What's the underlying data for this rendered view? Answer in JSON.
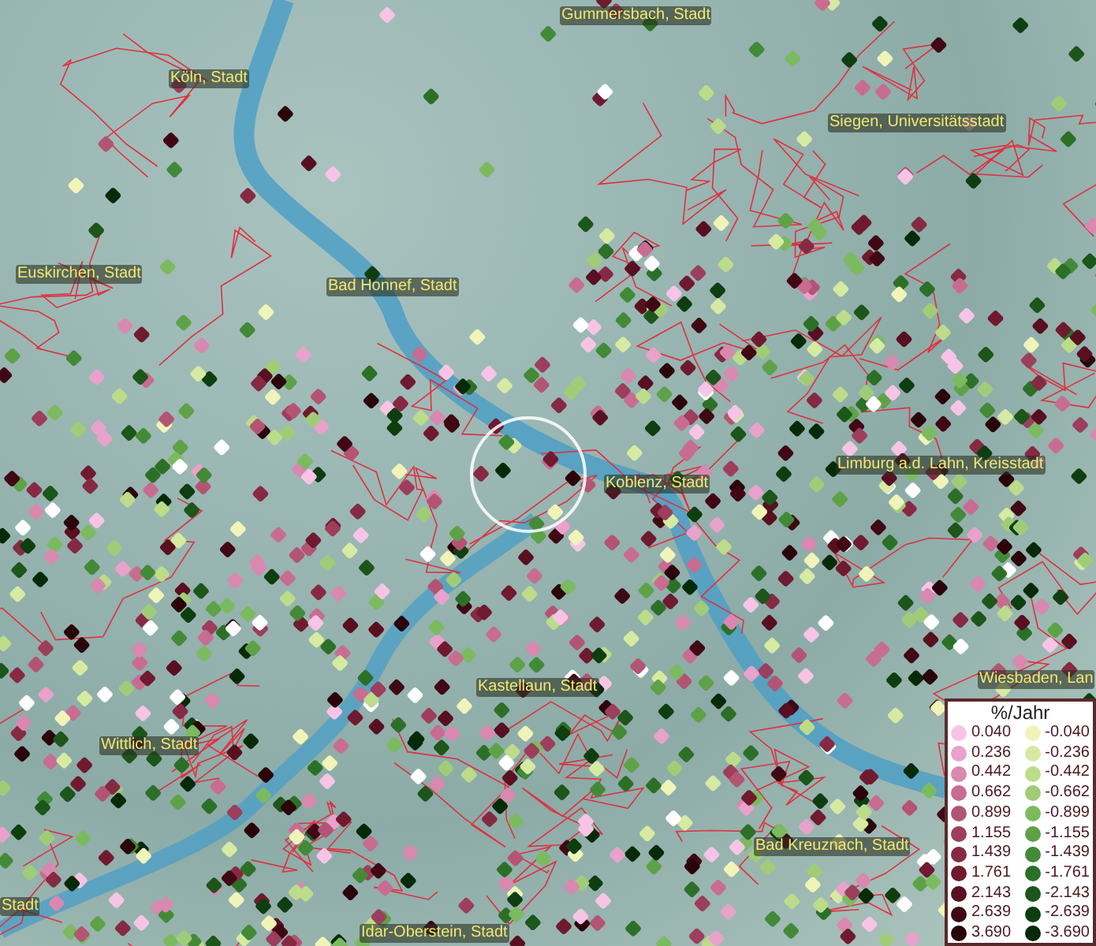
{
  "places": [
    "Gummersbach, Stadt",
    "Köln, Stadt",
    "Siegen, Universitätsstadt",
    "Euskirchen, Stadt",
    "Bad Honnef, Stadt",
    "Koblenz, Stadt",
    "Limburg a.d. Lahn, Kreisstadt",
    "Wiesbaden, Lan",
    "Kastellaun, Stadt",
    "Wittlich, Stadt",
    "Bad Kreuznach, Stadt",
    "Stadt",
    "Idar-Oberstein, Stadt"
  ],
  "legend": {
    "title": "%/Jahr",
    "rising": [
      {
        "value": "0.040",
        "color": "#f7c4e6"
      },
      {
        "value": "0.236",
        "color": "#e8a2cc"
      },
      {
        "value": "0.442",
        "color": "#d988b0"
      },
      {
        "value": "0.662",
        "color": "#c86c92"
      },
      {
        "value": "0.899",
        "color": "#b45474"
      },
      {
        "value": "1.155",
        "color": "#9c3e5c"
      },
      {
        "value": "1.439",
        "color": "#862a44"
      },
      {
        "value": "1.761",
        "color": "#701a30"
      },
      {
        "value": "2.143",
        "color": "#581020"
      },
      {
        "value": "2.639",
        "color": "#400814"
      },
      {
        "value": "3.690",
        "color": "#2a040a"
      }
    ],
    "falling": [
      {
        "value": "-0.040",
        "color": "#f0f4b8"
      },
      {
        "value": "-0.236",
        "color": "#d6eaa2"
      },
      {
        "value": "-0.442",
        "color": "#bcdc8a"
      },
      {
        "value": "-0.662",
        "color": "#a0cc78"
      },
      {
        "value": "-0.899",
        "color": "#7cba60"
      },
      {
        "value": "-1.155",
        "color": "#5ea248"
      },
      {
        "value": "-1.439",
        "color": "#428a38"
      },
      {
        "value": "-1.761",
        "color": "#2c7028"
      },
      {
        "value": "-2.143",
        "color": "#1c561a"
      },
      {
        "value": "-2.639",
        "color": "#0e3e10"
      },
      {
        "value": "-3.690",
        "color": "#062a08"
      }
    ]
  }
}
